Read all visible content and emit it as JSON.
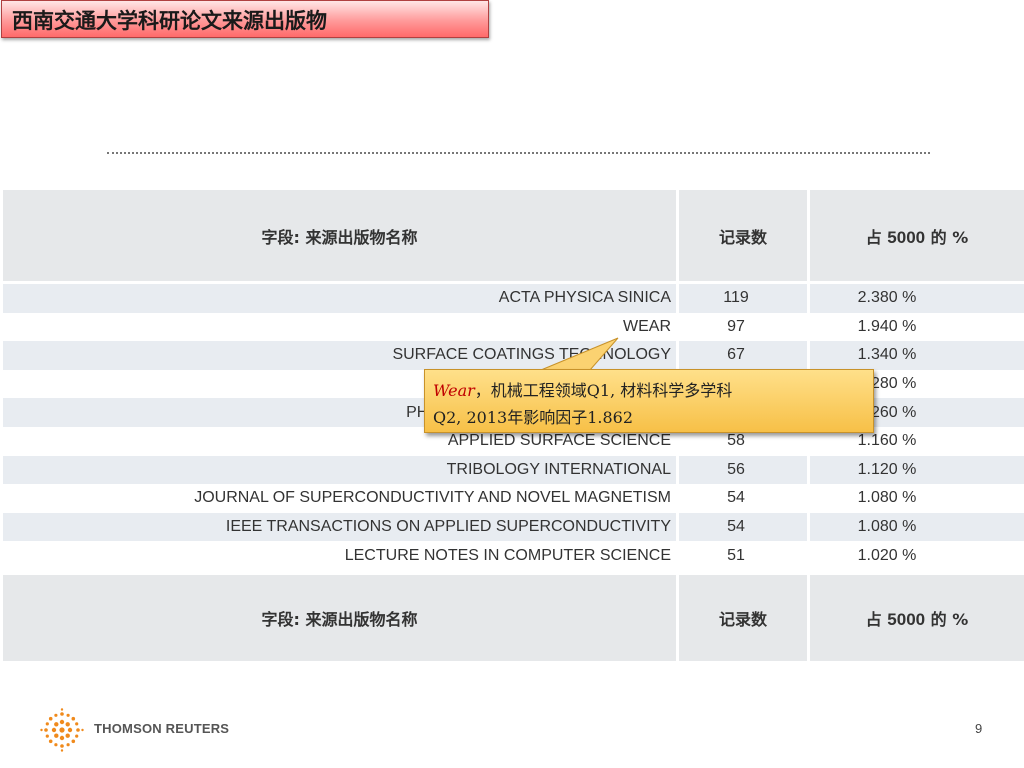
{
  "slide": {
    "title": "西南交通大学科研论文来源出版物",
    "page_number": "9"
  },
  "table": {
    "header": {
      "field": "字段: 来源出版物名称",
      "count": "记录数",
      "pct_prefix": "占 ",
      "pct_num": "5000",
      "pct_suffix": " 的 %"
    },
    "rows": [
      {
        "name": "ACTA PHYSICA SINICA",
        "count": "119",
        "pct": "2.380 %"
      },
      {
        "name": "WEAR",
        "count": "97",
        "pct": "1.940 %"
      },
      {
        "name": "SURFACE COATINGS TECHNOLOGY",
        "count": "67",
        "pct": "1.340 %"
      },
      {
        "name": "",
        "count": "",
        "pct": "1.280 %"
      },
      {
        "name": "PHYSICA C SUPERCONDUCTIVITY",
        "count": "",
        "pct": "1.260 %"
      },
      {
        "name": "APPLIED SURFACE SCIENCE",
        "count": "58",
        "pct": "1.160 %"
      },
      {
        "name": "TRIBOLOGY INTERNATIONAL",
        "count": "56",
        "pct": "1.120 %"
      },
      {
        "name": "JOURNAL OF SUPERCONDUCTIVITY AND NOVEL MAGNETISM",
        "count": "54",
        "pct": "1.080 %"
      },
      {
        "name": "IEEE TRANSACTIONS ON APPLIED SUPERCONDUCTIVITY",
        "count": "54",
        "pct": "1.080 %"
      },
      {
        "name": "LECTURE NOTES IN COMPUTER SCIENCE",
        "count": "51",
        "pct": "1.020 %"
      }
    ]
  },
  "callout": {
    "journal": "Wear",
    "line1_rest": "，机械工程领域Q1, 材料科学多学科",
    "line2": "Q2, 2013年影响因子1.862"
  },
  "footer": {
    "brand": "THOMSON REUTERS",
    "logo_icon": "thomson-reuters-dots-icon"
  },
  "colors": {
    "title_bg": "#ff8a8a",
    "header_bg": "#e6e8ea",
    "alt_row_bg": "#e8ecf1",
    "callout_bg": "#f7c047",
    "callout_accent": "#c00000",
    "logo_orange": "#f08a1c"
  }
}
